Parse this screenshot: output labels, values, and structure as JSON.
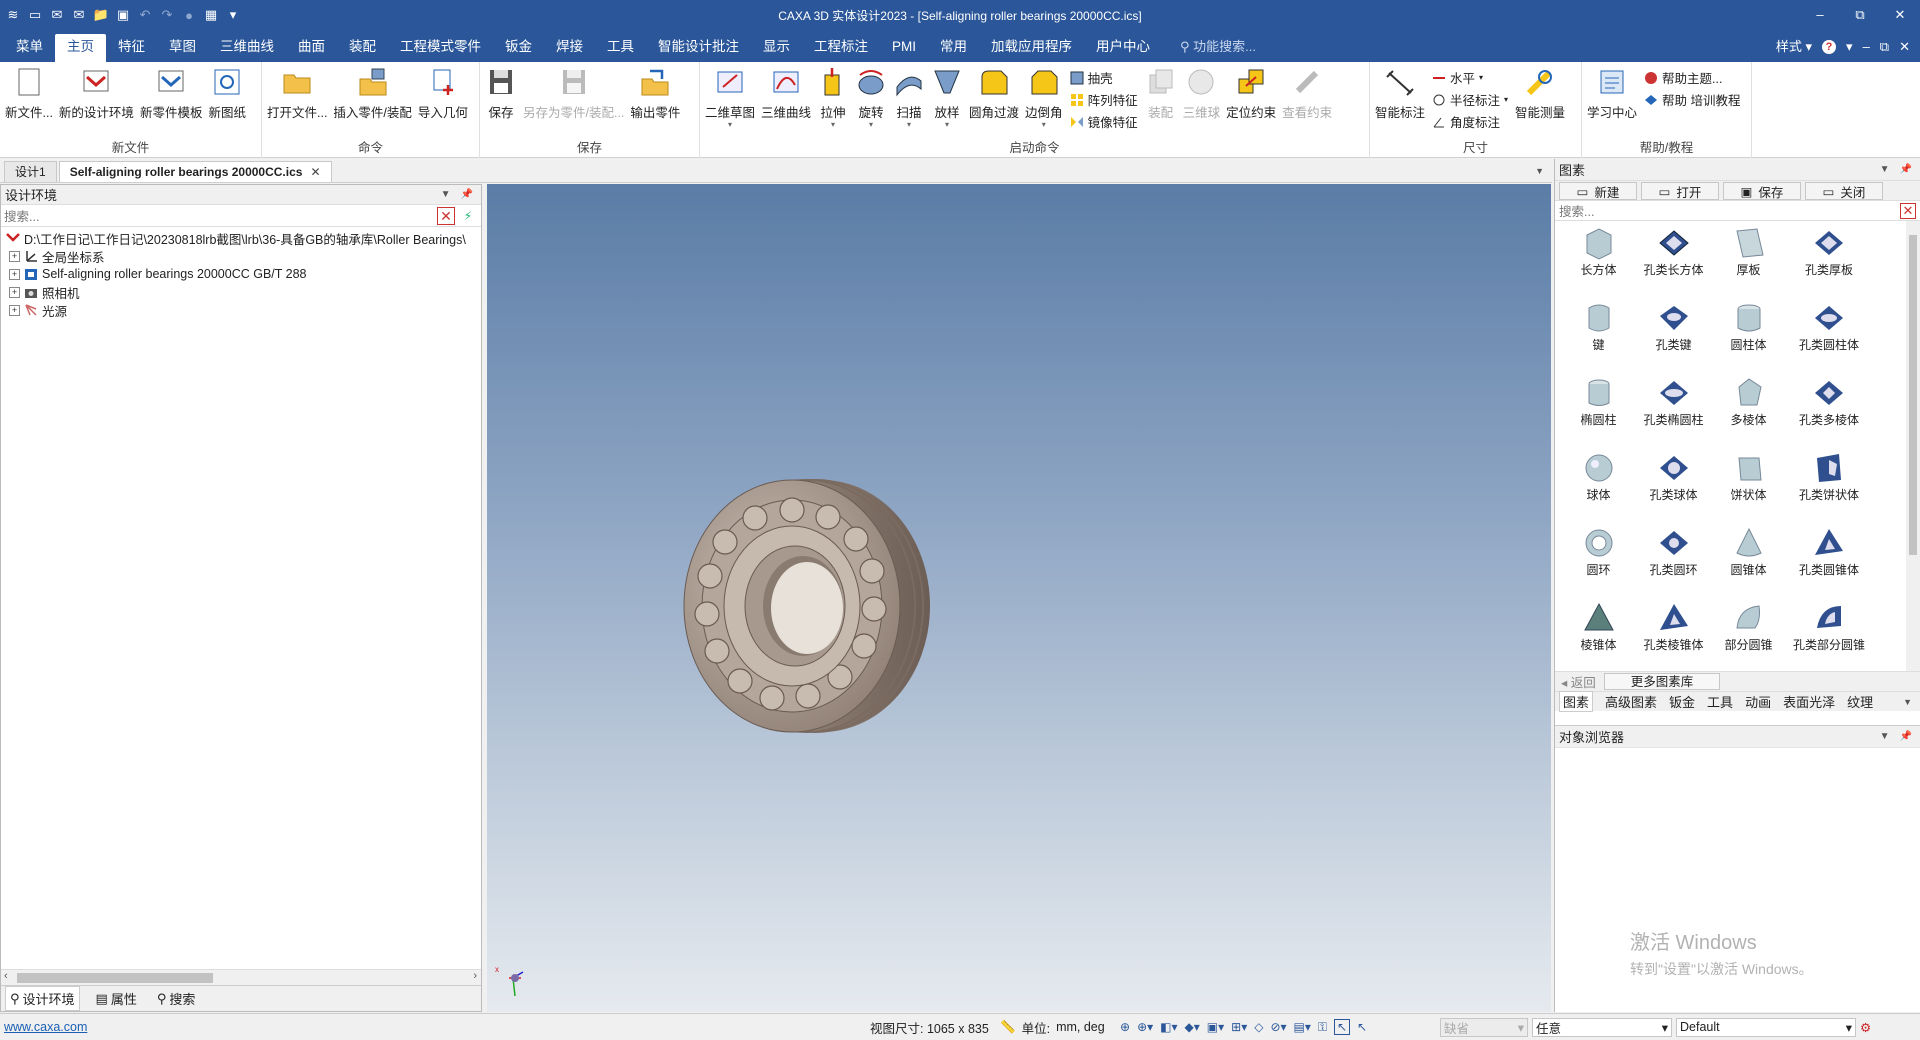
{
  "titlebar": {
    "title": "CAXA 3D 实体设计2023 - [Self-aligning roller bearings 20000CC.ics]",
    "minimize": "–",
    "restore": "⧉",
    "close": "✕"
  },
  "menu": {
    "tabs": [
      "菜单",
      "主页",
      "特征",
      "草图",
      "三维曲线",
      "曲面",
      "装配",
      "工程模式零件",
      "钣金",
      "焊接",
      "工具",
      "智能设计批注",
      "显示",
      "工程标注",
      "PMI",
      "常用",
      "加载应用程序",
      "用户中心"
    ],
    "active_index": 1,
    "search_placeholder": "功能搜索...",
    "style_label": "样式",
    "help_icon": "?",
    "win_min": "–",
    "win_restore": "⧉",
    "win_close": "✕"
  },
  "ribbon": {
    "groups": {
      "new_file": {
        "label": "新文件",
        "buttons": [
          "新文件...",
          "新的设计环境",
          "新零件模板",
          "新图纸"
        ]
      },
      "command": {
        "label": "命令",
        "buttons": [
          "打开文件...",
          "插入零件/装配",
          "导入几何"
        ]
      },
      "save": {
        "label": "保存",
        "buttons": [
          "保存",
          "另存为零件/装配...",
          "输出零件"
        ]
      },
      "launch": {
        "label": "启动命令",
        "buttons": [
          "二维草图",
          "三维曲线",
          "拉伸",
          "旋转",
          "扫描",
          "放样",
          "圆角过渡",
          "边倒角"
        ],
        "small": [
          "抽壳",
          "阵列特征",
          "镜像特征"
        ],
        "buttons2": [
          "装配",
          "三维球",
          "定位约束",
          "查看约束"
        ]
      },
      "dimension": {
        "label": "尺寸",
        "big": "智能标注",
        "small": [
          "水平",
          "半径标注",
          "角度标注"
        ],
        "big2": "智能测量"
      },
      "help": {
        "label": "帮助/教程",
        "big": "学习中心",
        "small": [
          "帮助主题...",
          "帮助 培训教程"
        ]
      }
    }
  },
  "doc_tabs": {
    "tab1": "设计1",
    "tab2": "Self-aligning roller bearings 20000CC.ics",
    "close": "✕"
  },
  "left_panel": {
    "title": "设计环境",
    "search_placeholder": "搜索...",
    "tree": [
      {
        "label": "D:\\工作日记\\工作日记\\20230818lrb截图\\lrb\\36-具备GB的轴承库\\Roller Bearings\\",
        "expand": ""
      },
      {
        "label": "全局坐标系",
        "expand": "+"
      },
      {
        "label": "Self-aligning roller bearings 20000CC GB/T 288",
        "expand": "+"
      },
      {
        "label": "照相机",
        "expand": "+"
      },
      {
        "label": "光源",
        "expand": "+"
      }
    ],
    "bottom_tabs": [
      "设计环境",
      "属性",
      "搜索"
    ]
  },
  "right_panel": {
    "title": "图素",
    "tools": [
      "新建",
      "打开",
      "保存",
      "关闭"
    ],
    "search_placeholder": "搜索...",
    "items": [
      "长方体",
      "孔类长方体",
      "厚板",
      "孔类厚板",
      "键",
      "孔类键",
      "圆柱体",
      "孔类圆柱体",
      "椭圆柱",
      "孔类椭圆柱",
      "多棱体",
      "孔类多棱体",
      "球体",
      "孔类球体",
      "饼状体",
      "孔类饼状体",
      "圆环",
      "孔类圆环",
      "圆锥体",
      "孔类圆锥体",
      "棱锥体",
      "孔类棱锥体",
      "部分圆锥",
      "孔类部分圆锥"
    ],
    "back": "返回",
    "more": "更多图素库",
    "tabs": [
      "图素",
      "高级图素",
      "钣金",
      "工具",
      "动画",
      "表面光泽",
      "纹理"
    ],
    "object_browser_title": "对象浏览器",
    "watermark_line1": "激活 Windows",
    "watermark_line2": "转到\"设置\"以激活 Windows。"
  },
  "status": {
    "link": "www.caxa.com",
    "view_size": "视图尺寸: 1065 x  835",
    "unit_label": "单位:",
    "unit_value": "mm, deg",
    "select1": "缺省",
    "select2": "任意",
    "select3": "Default"
  },
  "colors": {
    "brand": "#2b579a",
    "bearing": "#a8988c"
  }
}
